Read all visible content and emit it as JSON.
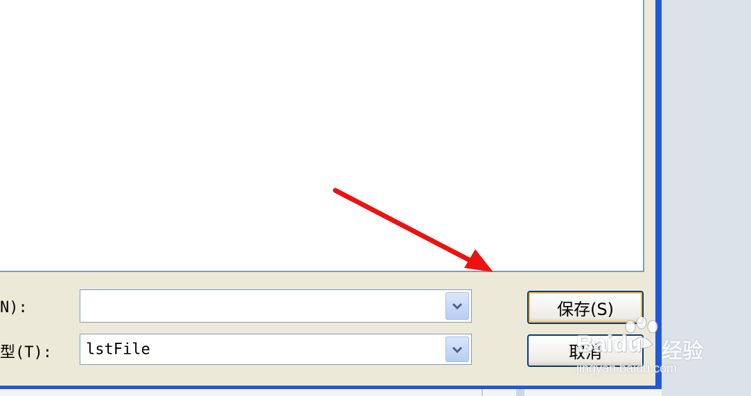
{
  "dialog": {
    "filename_label": "N):",
    "filetype_label": "型(T):",
    "filename_value": "",
    "filetype_value": "lstFile",
    "save_button": "保存(S)",
    "cancel_button": "取消"
  },
  "watermark": {
    "brand": "Baidu",
    "product": "经验",
    "url": "jingyan.baidu.com"
  },
  "colors": {
    "window_border": "#2158d8",
    "dialog_bg": "#ece9d8",
    "annotation_arrow": "#ee1111",
    "control_border": "#7f9db9"
  },
  "icons": {
    "dropdown": "chevron-down-icon",
    "annotation": "red-arrow-icon",
    "paw": "paw-icon"
  }
}
